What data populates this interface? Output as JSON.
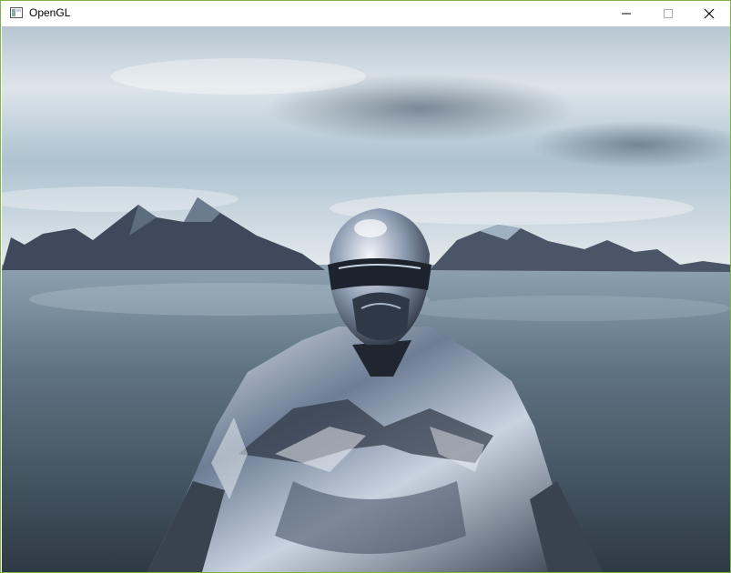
{
  "window": {
    "title": "OpenGL",
    "icon": "app-window-icon",
    "controls": {
      "minimize": "minimize-icon",
      "maximize": "maximize-icon",
      "close": "close-icon"
    }
  },
  "scene": {
    "sky_colors": [
      "#c7d4dd",
      "#8fa8bb",
      "#e8eef1"
    ],
    "water_color": "#4a5d6c",
    "mountain_color": "#3f4b5c",
    "model": "chrome-armored-figure"
  }
}
